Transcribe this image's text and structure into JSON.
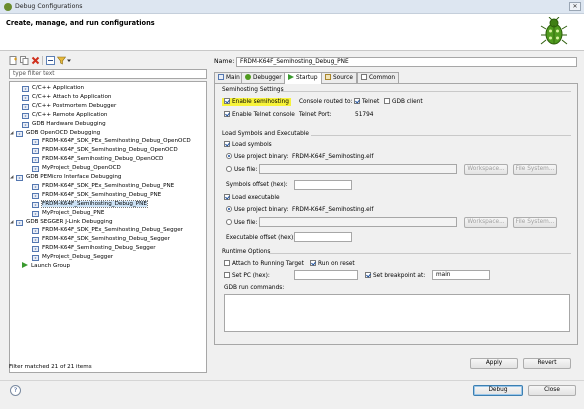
{
  "window": {
    "title": "Debug Configurations",
    "close_glyph": "✕"
  },
  "header": {
    "title": "Create, manage, and run configurations",
    "icon": "bug-icon"
  },
  "left": {
    "filter_placeholder": "type filter text",
    "status": "Filter matched 21 of 21 items",
    "toolbar": [
      "new-config-icon",
      "duplicate-icon",
      "delete-icon",
      "collapse-all-icon",
      "filter-icon",
      "dropdown-icon"
    ],
    "tree": [
      {
        "label": "C/C++ Application",
        "level": 1,
        "type": "config"
      },
      {
        "label": "C/C++ Attach to Application",
        "level": 1,
        "type": "config"
      },
      {
        "label": "C/C++ Postmortem Debugger",
        "level": 1,
        "type": "config"
      },
      {
        "label": "C/C++ Remote Application",
        "level": 1,
        "type": "config"
      },
      {
        "label": "GDB Hardware Debugging",
        "level": 1,
        "type": "config"
      },
      {
        "label": "GDB OpenOCD Debugging",
        "level": 0,
        "type": "group",
        "expanded": true
      },
      {
        "label": "FRDM-K64F_SDK_PEx_Semihosting_Debug_OpenOCD",
        "level": 2,
        "type": "config"
      },
      {
        "label": "FRDM-K64F_SDK_Semihosting_Debug_OpenOCD",
        "level": 2,
        "type": "config"
      },
      {
        "label": "FRDM-K64F_Semihosting_Debug_OpenOCD",
        "level": 2,
        "type": "config"
      },
      {
        "label": "MyProject_Debug_OpenOCD",
        "level": 2,
        "type": "config"
      },
      {
        "label": "GDB PEMicro Interface Debugging",
        "level": 0,
        "type": "group",
        "expanded": true
      },
      {
        "label": "FRDM-K64F_SDK_PEx_Semihosting_Debug_PNE",
        "level": 2,
        "type": "config"
      },
      {
        "label": "FRDM-K64F_SDK_Semihosting_Debug_PNE",
        "level": 2,
        "type": "config"
      },
      {
        "label": "FRDM-K64F_Semihosting_Debug_PNE",
        "level": 2,
        "type": "config",
        "selected": true
      },
      {
        "label": "MyProject_Debug_PNE",
        "level": 2,
        "type": "config"
      },
      {
        "label": "GDB SEGGER J-Link Debugging",
        "level": 0,
        "type": "group",
        "expanded": true
      },
      {
        "label": "FRDM-K64F_SDK_PEx_Semihosting_Debug_Segger",
        "level": 2,
        "type": "config"
      },
      {
        "label": "FRDM-K64F_SDK_Semihosting_Debug_Segger",
        "level": 2,
        "type": "config"
      },
      {
        "label": "FRDM-K64F_Semihosting_Debug_Segger",
        "level": 2,
        "type": "config"
      },
      {
        "label": "MyProject_Debug_Segger",
        "level": 2,
        "type": "config"
      },
      {
        "label": "Launch Group",
        "level": 1,
        "type": "launch"
      }
    ]
  },
  "right": {
    "name_label": "Name:",
    "name_value": "FRDM-K64F_Semihosting_Debug_PNE",
    "tabs": [
      {
        "label": "Main",
        "icon": "main-tab-icon"
      },
      {
        "label": "Debugger",
        "icon": "debugger-tab-icon"
      },
      {
        "label": "Startup",
        "icon": "startup-tab-icon",
        "active": true
      },
      {
        "label": "Source",
        "icon": "source-tab-icon"
      },
      {
        "label": "Common",
        "icon": "common-tab-icon"
      }
    ],
    "semihosting": {
      "title": "Semihosting Settings",
      "enable_semihosting": "Enable semihosting",
      "console_routed": "Console routed to:",
      "telnet": "Telnet",
      "gdb_client": "GDB client",
      "enable_telnet_console": "Enable Telnet console",
      "telnet_port_label": "Telnet Port:",
      "telnet_port_value": "51794",
      "highlight_color": "#f7f33a"
    },
    "load": {
      "title": "Load Symbols and Executable",
      "load_symbols": "Load symbols",
      "use_project_binary": "Use project binary:",
      "symbols_binary": "FRDM-K64F_Semihosting.elf",
      "use_file": "Use file:",
      "workspace_btn": "Workspace...",
      "filesystem_btn": "File System...",
      "symbols_offset": "Symbols offset (hex):",
      "load_executable": "Load executable",
      "exec_binary": "FRDM-K64F_Semihosting.elf",
      "exec_offset": "Executable offset (hex):"
    },
    "runtime": {
      "title": "Runtime Options",
      "attach": "Attach to Running Target",
      "run_on_reset": "Run on reset",
      "set_pc": "Set PC (hex):",
      "set_breakpoint": "Set breakpoint at:",
      "breakpoint_value": "main",
      "gdb_commands": "GDB run commands:"
    },
    "apply": "Apply",
    "revert": "Revert"
  },
  "footer": {
    "help": "?",
    "debug": "Debug",
    "close": "Close"
  }
}
